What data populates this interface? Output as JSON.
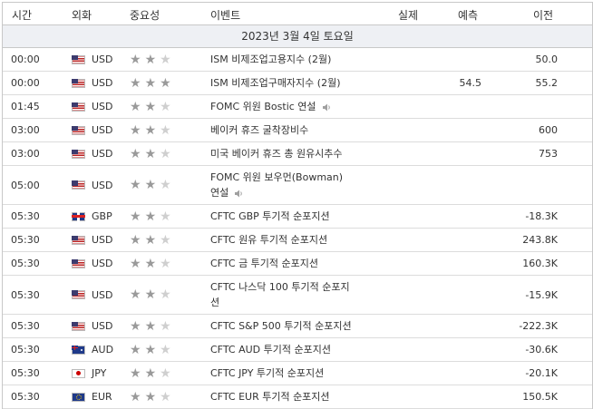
{
  "header": {
    "time": "시간",
    "currency": "외화",
    "importance": "중요성",
    "event": "이벤트",
    "actual": "실제",
    "forecast": "예측",
    "previous": "이전"
  },
  "date_label": "2023년 3월 4일 토요일",
  "rows": [
    {
      "time": "00:00",
      "flag": "us",
      "currency": "USD",
      "stars": 2,
      "event_l1": "ISM 비제조업고용지수 (2월)",
      "event_l2": "",
      "speaker": false,
      "forecast": "",
      "previous": "50.0"
    },
    {
      "time": "00:00",
      "flag": "us",
      "currency": "USD",
      "stars": 3,
      "event_l1": "ISM 비제조업구매자지수 (2월)",
      "event_l2": "",
      "speaker": false,
      "forecast": "54.5",
      "previous": "55.2"
    },
    {
      "time": "01:45",
      "flag": "us",
      "currency": "USD",
      "stars": 2,
      "event_l1": "FOMC 위원 Bostic 연설",
      "event_l2": "",
      "speaker": true,
      "forecast": "",
      "previous": ""
    },
    {
      "time": "03:00",
      "flag": "us",
      "currency": "USD",
      "stars": 2,
      "event_l1": "베이커 휴즈 굴착장비수",
      "event_l2": "",
      "speaker": false,
      "forecast": "",
      "previous": "600"
    },
    {
      "time": "03:00",
      "flag": "us",
      "currency": "USD",
      "stars": 2,
      "event_l1": "미국 베이커 휴즈 총 원유시추수",
      "event_l2": "",
      "speaker": false,
      "forecast": "",
      "previous": "753"
    },
    {
      "time": "05:00",
      "flag": "us",
      "currency": "USD",
      "stars": 2,
      "event_l1": "FOMC 위원 보우먼(Bowman)",
      "event_l2": "연설",
      "speaker": true,
      "forecast": "",
      "previous": ""
    },
    {
      "time": "05:30",
      "flag": "gb",
      "currency": "GBP",
      "stars": 2,
      "event_l1": "CFTC GBP 투기적 순포지션",
      "event_l2": "",
      "speaker": false,
      "forecast": "",
      "previous": "-18.3K"
    },
    {
      "time": "05:30",
      "flag": "us",
      "currency": "USD",
      "stars": 2,
      "event_l1": "CFTC 원유 투기적 순포지션",
      "event_l2": "",
      "speaker": false,
      "forecast": "",
      "previous": "243.8K"
    },
    {
      "time": "05:30",
      "flag": "us",
      "currency": "USD",
      "stars": 2,
      "event_l1": "CFTC 금 투기적 순포지션",
      "event_l2": "",
      "speaker": false,
      "forecast": "",
      "previous": "160.3K"
    },
    {
      "time": "05:30",
      "flag": "us",
      "currency": "USD",
      "stars": 2,
      "event_l1": "CFTC 나스닥 100 투기적 순포지",
      "event_l2": "션",
      "speaker": false,
      "forecast": "",
      "previous": "-15.9K"
    },
    {
      "time": "05:30",
      "flag": "us",
      "currency": "USD",
      "stars": 2,
      "event_l1": "CFTC S&P 500 투기적 순포지션",
      "event_l2": "",
      "speaker": false,
      "forecast": "",
      "previous": "-222.3K"
    },
    {
      "time": "05:30",
      "flag": "au",
      "currency": "AUD",
      "stars": 2,
      "event_l1": "CFTC AUD 투기적 순포지션",
      "event_l2": "",
      "speaker": false,
      "forecast": "",
      "previous": "-30.6K"
    },
    {
      "time": "05:30",
      "flag": "jp",
      "currency": "JPY",
      "stars": 2,
      "event_l1": "CFTC JPY 투기적 순포지션",
      "event_l2": "",
      "speaker": false,
      "forecast": "",
      "previous": "-20.1K"
    },
    {
      "time": "05:30",
      "flag": "eu",
      "currency": "EUR",
      "stars": 2,
      "event_l1": "CFTC EUR 투기적 순포지션",
      "event_l2": "",
      "speaker": false,
      "forecast": "",
      "previous": "150.5K"
    }
  ],
  "colors": {
    "star_on": "#9a9a9a",
    "star_off": "#cfcfcf",
    "date_row_bg": "#eef0f4"
  },
  "icons": {
    "star": "star-icon",
    "speaker": "speaker-icon"
  }
}
